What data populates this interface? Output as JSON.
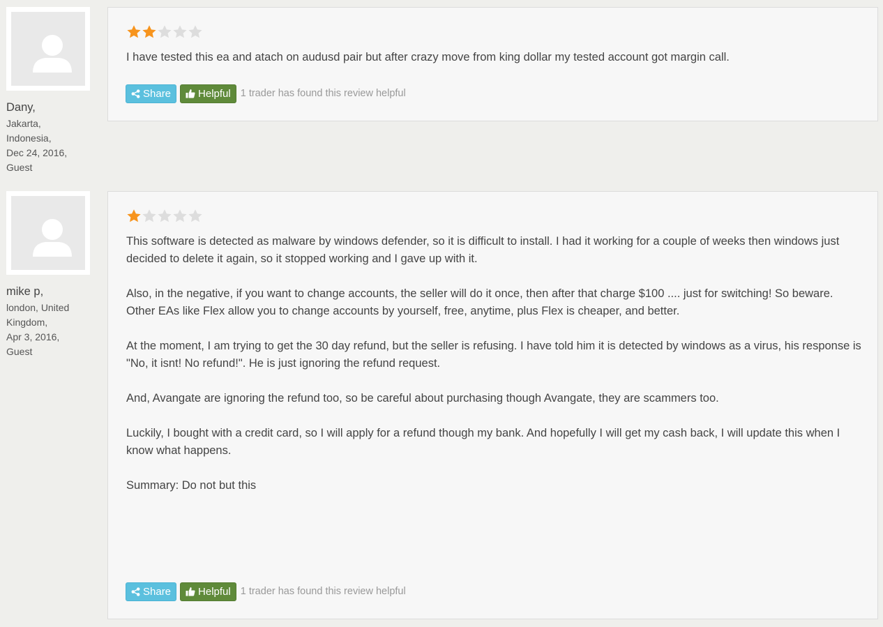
{
  "reviews": [
    {
      "author": {
        "name": "Dany,",
        "city": "Jakarta,",
        "country": "Indonesia,",
        "date": "Dec 24, 2016,",
        "role": "Guest"
      },
      "rating": 2,
      "rating_max": 5,
      "paragraphs": [
        "I have tested this ea and atach on audusd pair but after crazy move from king dollar my tested account got margin call."
      ],
      "share_label": "Share",
      "helpful_label": "Helpful",
      "helpful_note": "1 trader has found this review helpful"
    },
    {
      "author": {
        "name": "mike p,",
        "city": "london, United",
        "country": "Kingdom,",
        "date": "Apr 3, 2016,",
        "role": "Guest"
      },
      "rating": 1,
      "rating_max": 5,
      "paragraphs": [
        "This software is detected as malware by windows defender, so it is difficult to install. I had it working for a couple of weeks then windows just decided to delete it again, so it stopped working and I gave up with it.",
        "Also, in the negative, if you want to change accounts, the seller will do it once, then after that charge $100 .... just for switching! So beware. Other EAs like Flex allow you to change accounts by yourself, free, anytime, plus Flex is cheaper, and better.",
        "At the moment, I am trying to get the 30 day refund, but the seller is refusing. I have told him it is detected by windows as a virus, his response is \"No, it isnt! No refund!\". He is just ignoring the refund request.",
        "And, Avangate are ignoring the refund too, so be careful about purchasing though Avangate, they are scammers too.",
        "Luckily, I bought with a credit card, so I will apply for a refund though my bank. And hopefully I will get my cash back, I will update this when I know what happens.",
        "Summary: Do not but this"
      ],
      "share_label": "Share",
      "helpful_label": "Helpful",
      "helpful_note": "1 trader has found this review helpful"
    }
  ],
  "colors": {
    "star_filled": "#f7941d",
    "star_empty": "#dddddd",
    "share_button": "#5bc0de",
    "helpful_button": "#5f8a3a"
  },
  "icons": [
    "avatar-placeholder-icon",
    "star-icon",
    "share-icon",
    "thumbs-up-icon"
  ]
}
